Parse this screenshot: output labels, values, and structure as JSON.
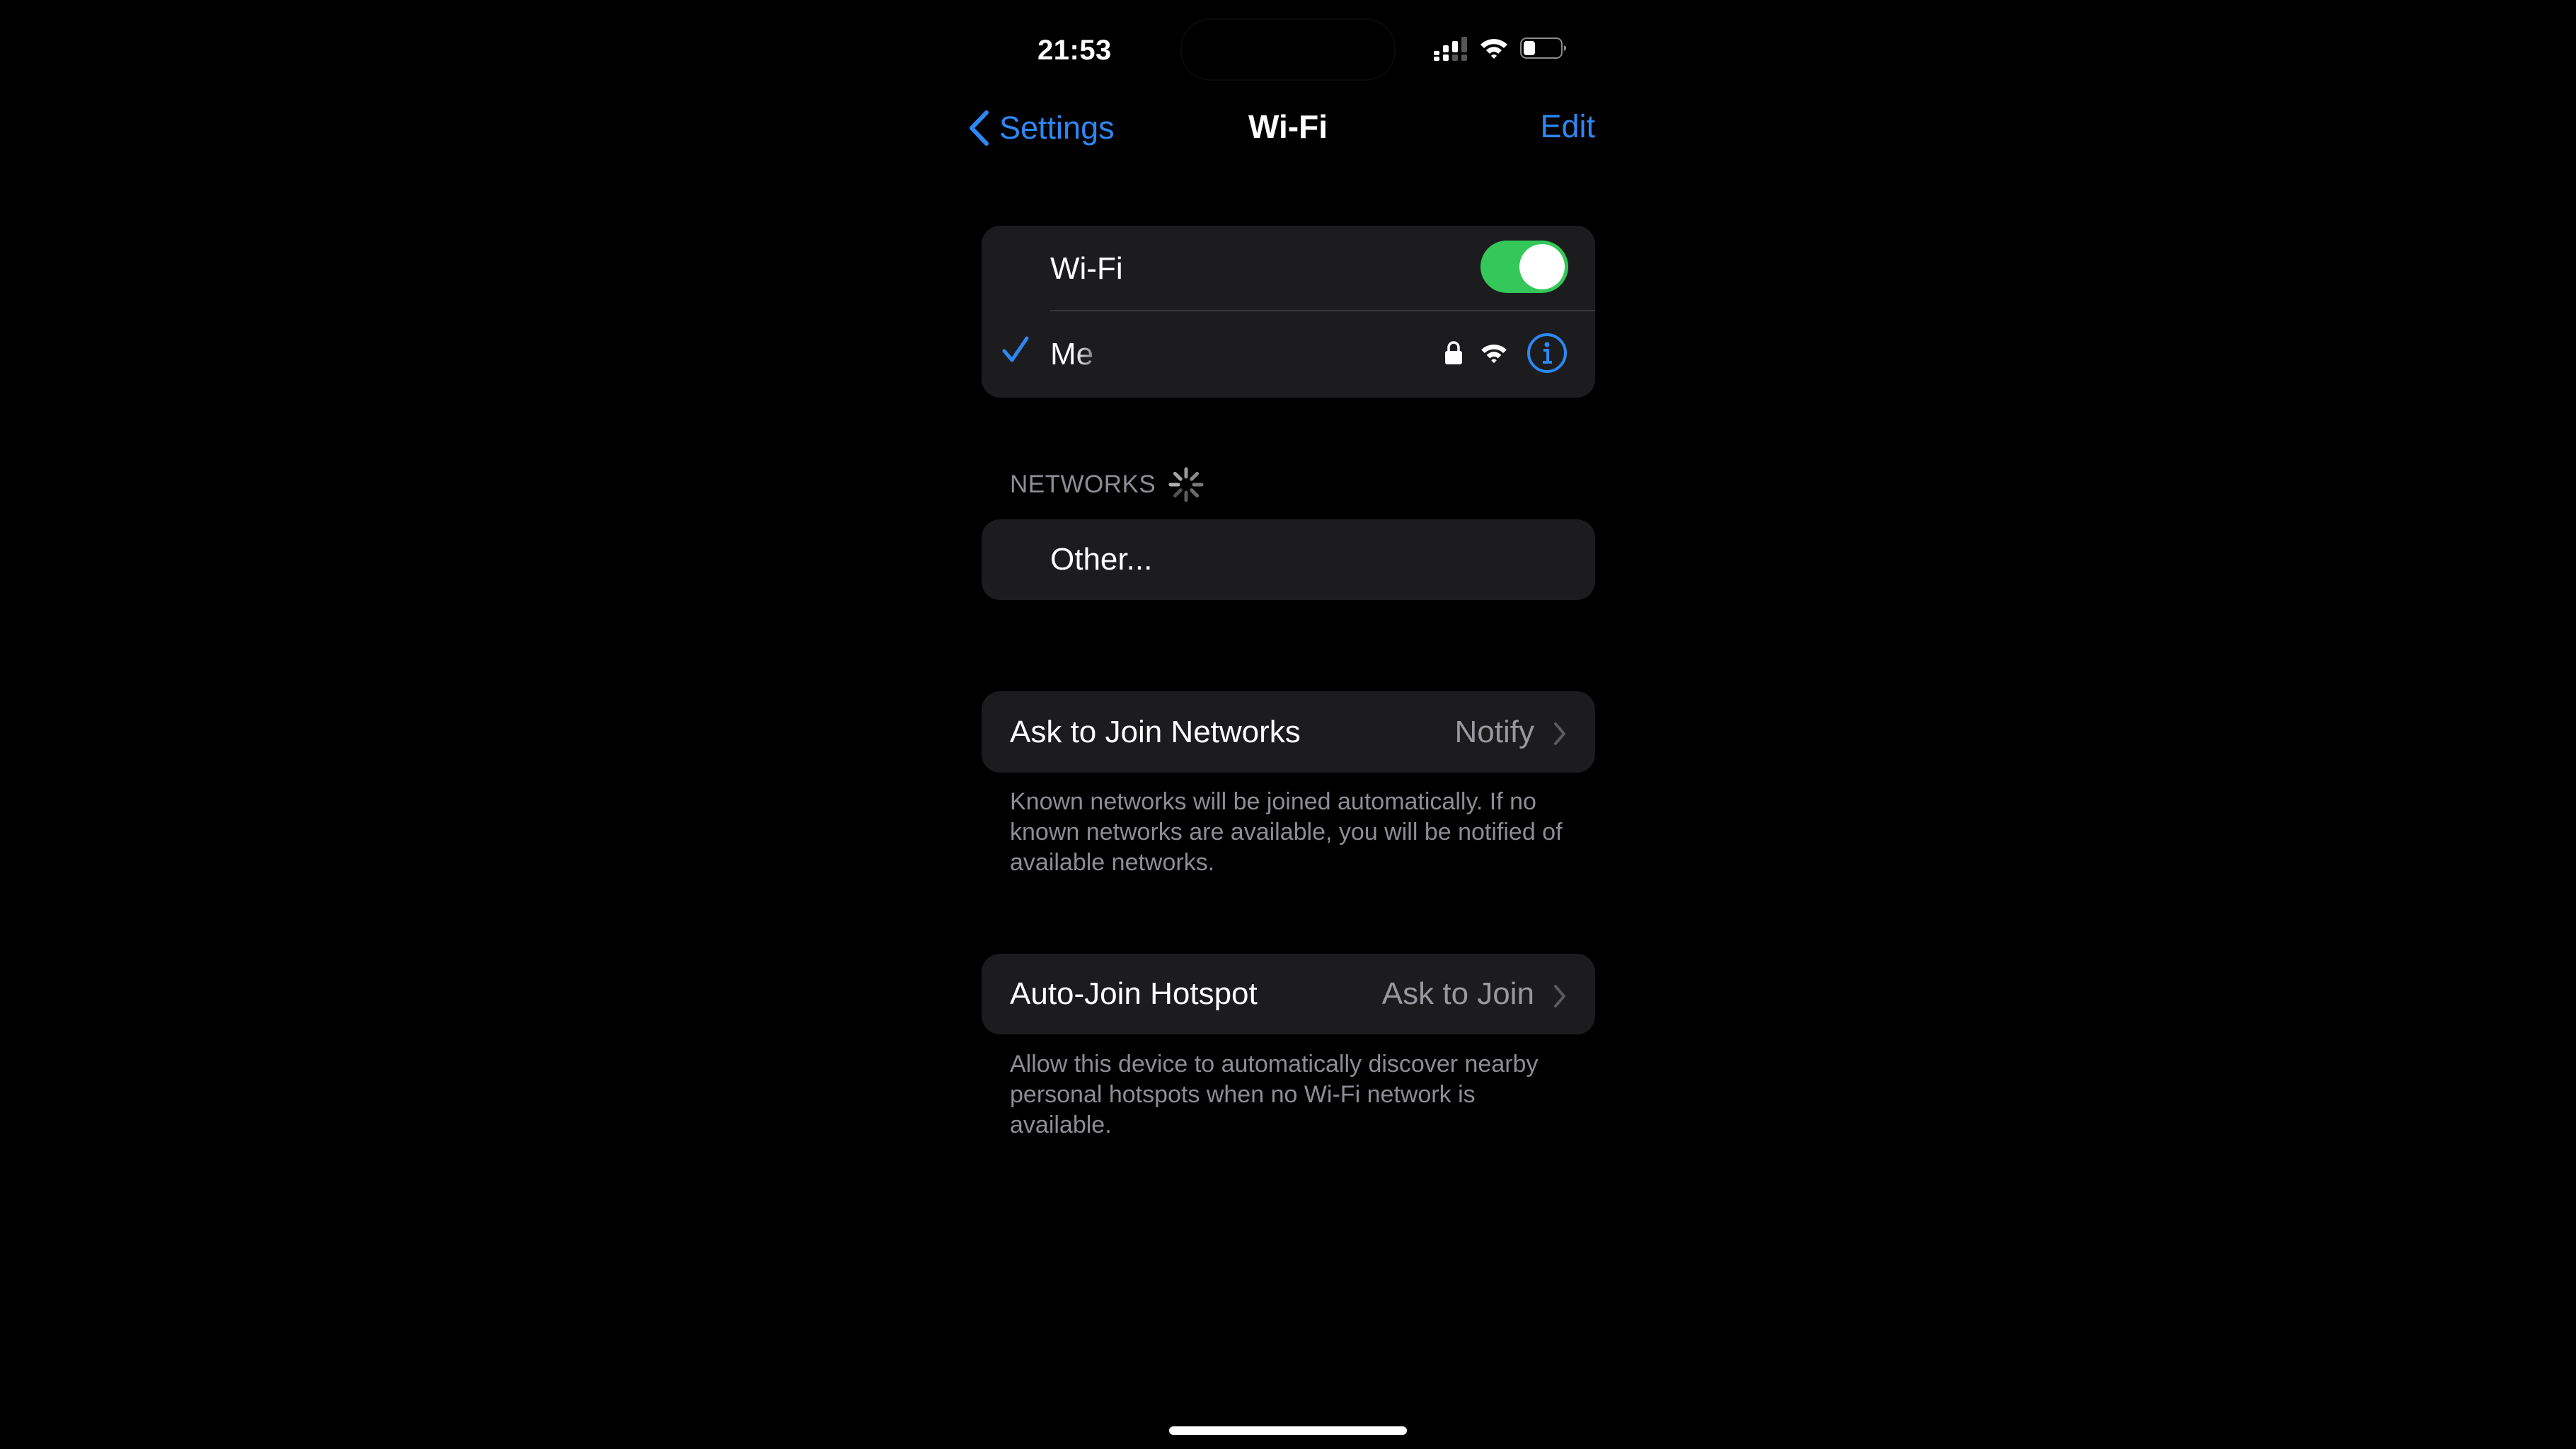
{
  "status_bar": {
    "time": "21:53",
    "signal_icon": "cellular-signal-icon",
    "signal_bars_active": 2,
    "signal_bars_total": 4,
    "wifi_icon": "wifi-icon",
    "battery_icon": "battery-icon",
    "battery_level_percent": 30
  },
  "nav": {
    "back_label": "Settings",
    "back_icon": "chevron-left-icon",
    "title": "Wi-Fi",
    "edit_label": "Edit"
  },
  "wifi_card": {
    "toggle_label": "Wi-Fi",
    "toggle_on": true,
    "connected_network": {
      "name": "Me",
      "checkmark_icon": "checkmark-icon",
      "lock_icon": "lock-icon",
      "wifi_icon": "wifi-icon",
      "info_icon": "info-icon"
    }
  },
  "networks_section": {
    "header": "NETWORKS",
    "spinner_icon": "loading-spinner-icon",
    "other_label": "Other..."
  },
  "ask_to_join": {
    "label": "Ask to Join Networks",
    "value": "Notify",
    "footnote": "Known networks will be joined automatically. If no known networks are available, you will be notified of available networks."
  },
  "auto_join_hotspot": {
    "label": "Auto-Join Hotspot",
    "value": "Ask to Join",
    "footnote": "Allow this device to automatically discover nearby personal hotspots when no Wi-Fi network is available."
  },
  "colors": {
    "accent_blue": "#2d87f5",
    "toggle_green": "#34c759",
    "card_bg": "#1c1c1e",
    "secondary_text": "#8d8d93"
  }
}
